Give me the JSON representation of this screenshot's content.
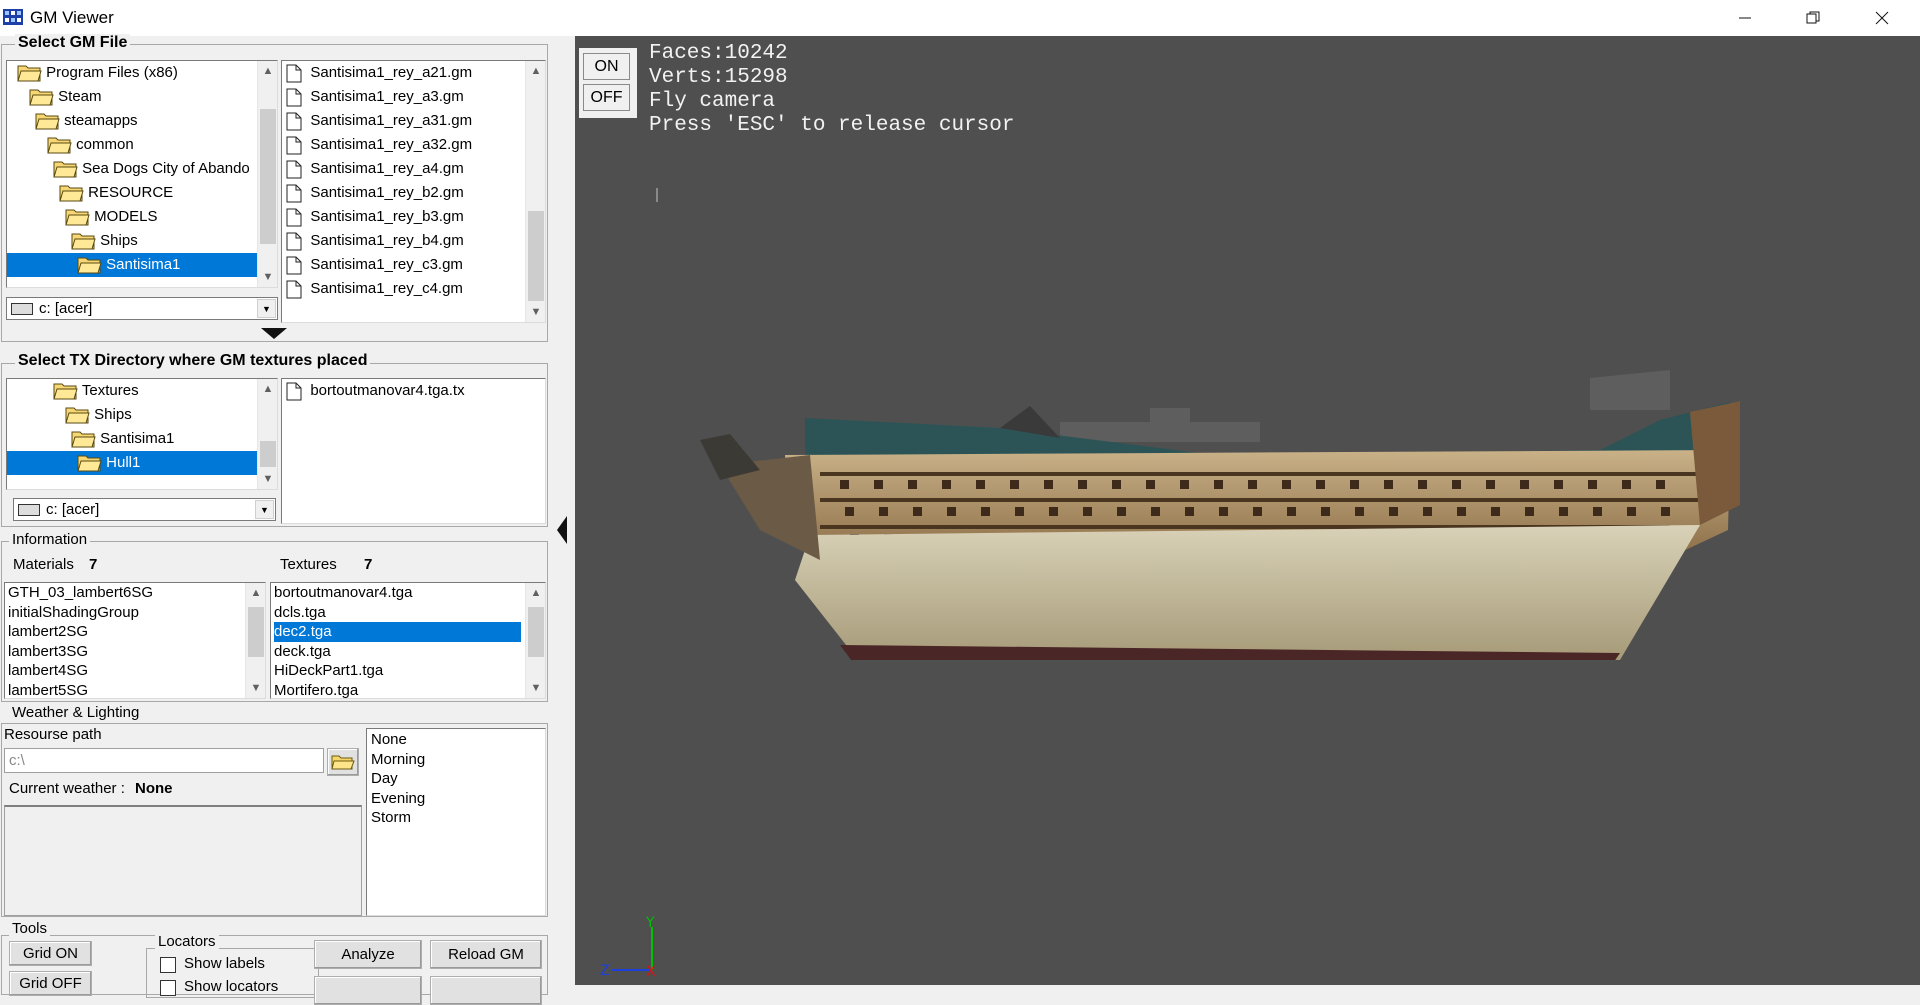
{
  "window": {
    "title": "GM Viewer"
  },
  "gm_panel": {
    "title": "Select GM File",
    "tree": [
      {
        "label": "Program Files (x86)"
      },
      {
        "label": "Steam"
      },
      {
        "label": "steamapps"
      },
      {
        "label": "common"
      },
      {
        "label": "Sea Dogs City of Abando"
      },
      {
        "label": "RESOURCE"
      },
      {
        "label": "MODELS"
      },
      {
        "label": "Ships"
      },
      {
        "label": "Santisima1",
        "selected": true
      }
    ],
    "files": [
      "Santisima1_rey_a21.gm",
      "Santisima1_rey_a3.gm",
      "Santisima1_rey_a31.gm",
      "Santisima1_rey_a32.gm",
      "Santisima1_rey_a4.gm",
      "Santisima1_rey_b2.gm",
      "Santisima1_rey_b3.gm",
      "Santisima1_rey_b4.gm",
      "Santisima1_rey_c3.gm",
      "Santisima1_rey_c4.gm"
    ],
    "drive": "c: [acer]"
  },
  "tx_panel": {
    "title": "Select TX Directory where GM textures placed",
    "tree": [
      {
        "label": "Textures"
      },
      {
        "label": "Ships"
      },
      {
        "label": "Santisima1"
      },
      {
        "label": "Hull1",
        "selected": true
      }
    ],
    "files": [
      "bortoutmanovar4.tga.tx"
    ],
    "drive": "c: [acer]"
  },
  "info": {
    "title": "Information",
    "materials_label": "Materials",
    "materials_count": "7",
    "textures_label": "Textures",
    "textures_count": "7",
    "materials": [
      "GTH_03_lambert6SG",
      "initialShadingGroup",
      "lambert2SG",
      "lambert3SG",
      "lambert4SG",
      "lambert5SG"
    ],
    "textures": [
      "bortoutmanovar4.tga",
      "dcls.tga",
      "dec2.tga",
      "deck.tga",
      "HiDeckPart1.tga",
      "Mortifero.tga"
    ],
    "selected_texture": 2
  },
  "weather": {
    "title": "Weather & Lighting",
    "resource_label": "Resourse path",
    "path_value": "c:\\",
    "current_label": "Current weather :",
    "current_value": "None",
    "options": [
      "None",
      "Morning",
      "Day",
      "Evening",
      "Storm"
    ]
  },
  "tools": {
    "title": "Tools",
    "grid_on": "Grid ON",
    "grid_off": "Grid OFF",
    "locators_title": "Locators",
    "show_labels": "Show labels",
    "show_locators": "Show locators",
    "analyze": "Analyze",
    "reload": "Reload GM"
  },
  "viewport": {
    "on_label": "ON",
    "off_label": "OFF",
    "hud": [
      "Faces:10242",
      "Verts:15298",
      "Fly camera",
      "Press 'ESC' to release cursor"
    ],
    "axis_y": "Y",
    "axis_z": "Z",
    "axis_x": "X"
  },
  "colors": {
    "selection": "#0078d7",
    "viewport_bg": "#4f4f4f",
    "hud_text": "#f2f2f2"
  }
}
